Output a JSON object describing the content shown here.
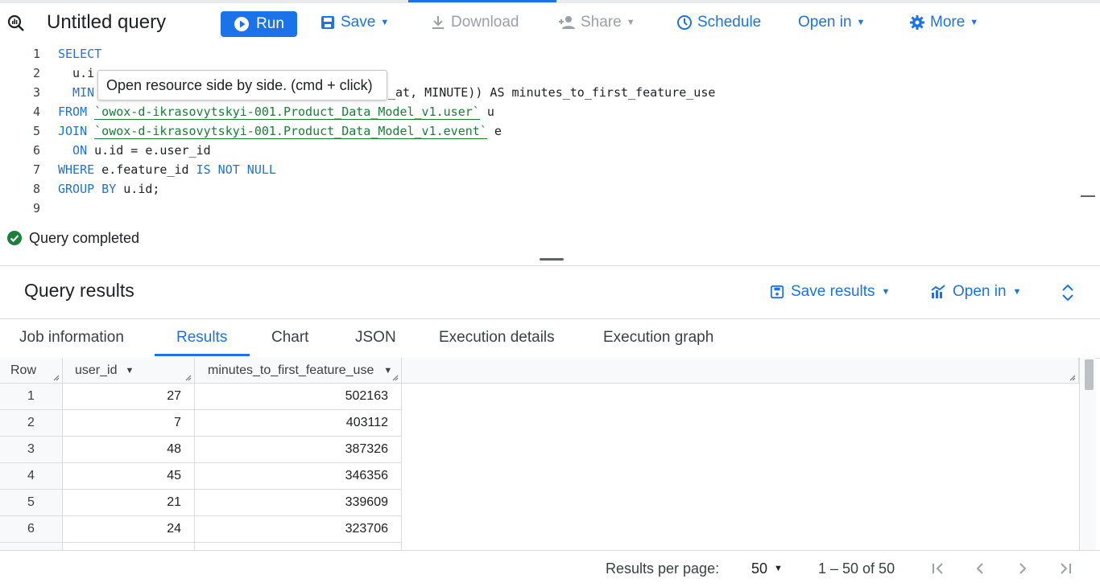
{
  "toolbar": {
    "title": "Untitled query",
    "run_label": "Run",
    "save_label": "Save",
    "download_label": "Download",
    "share_label": "Share",
    "schedule_label": "Schedule",
    "open_in_label": "Open in",
    "more_label": "More"
  },
  "editor": {
    "line_numbers": [
      "1",
      "2",
      "3",
      "4",
      "5",
      "6",
      "7",
      "8",
      "9"
    ],
    "lines": {
      "l1_kw": "SELECT",
      "l2_text": "  u.i",
      "l3_kw": "  MIN",
      "l3_text": "_at, MINUTE)) AS minutes_to_first_feature_use",
      "l4_kw": "FROM ",
      "l4_str": "`owox-d-ikrasovytskyi-001.Product_Data_Model_v1.user`",
      "l4_tail": " u",
      "l5_kw": "JOIN ",
      "l5_str": "`owox-d-ikrasovytskyi-001.Product_Data_Model_v1.event`",
      "l5_tail": " e",
      "l6_kw": "  ON",
      "l6_text": " u.id = e.user_id",
      "l7_kw": "WHERE",
      "l7_text": " e.feature_id ",
      "l7_kw2": "IS NOT NULL",
      "l8_kw": "GROUP BY",
      "l8_text": " u.id;"
    },
    "tooltip": "Open resource side by side. (cmd + click)"
  },
  "status": {
    "text": "Query completed"
  },
  "results": {
    "title": "Query results",
    "save_results_label": "Save results",
    "open_in_label": "Open in",
    "tabs": [
      "Job information",
      "Results",
      "Chart",
      "JSON",
      "Execution details",
      "Execution graph"
    ],
    "columns": [
      "Row",
      "user_id",
      "minutes_to_first_feature_use"
    ],
    "rows": [
      {
        "row": "1",
        "user_id": "27",
        "minutes": "502163"
      },
      {
        "row": "2",
        "user_id": "7",
        "minutes": "403112"
      },
      {
        "row": "3",
        "user_id": "48",
        "minutes": "387326"
      },
      {
        "row": "4",
        "user_id": "45",
        "minutes": "346356"
      },
      {
        "row": "5",
        "user_id": "21",
        "minutes": "339609"
      },
      {
        "row": "6",
        "user_id": "24",
        "minutes": "323706"
      }
    ]
  },
  "pagination": {
    "per_page_label": "Results per page:",
    "per_page_value": "50",
    "range": "1 – 50 of 50"
  },
  "colors": {
    "accent": "#1a73e8",
    "success": "#188038"
  }
}
